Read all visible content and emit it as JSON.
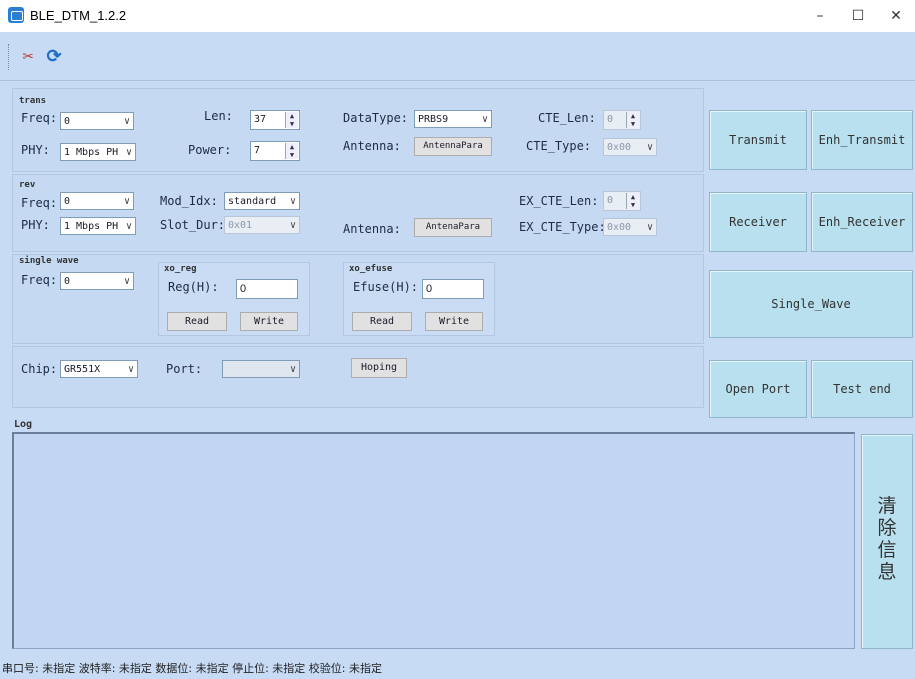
{
  "window": {
    "title": "BLE_DTM_1.2.2",
    "minimize": "–",
    "maximize": "☐",
    "close": "✕"
  },
  "toolbar": {
    "tools_icon": "✂",
    "refresh_icon": "⟳"
  },
  "trans": {
    "group": "trans",
    "freq_label": "Freq:",
    "freq_value": "0",
    "phy_label": "PHY:",
    "phy_value": "1 Mbps PH",
    "len_label": "Len:",
    "len_value": "37",
    "power_label": "Power:",
    "power_value": "7",
    "datatype_label": "DataType:",
    "datatype_value": "PRBS9",
    "antenna_label": "Antenna:",
    "antenna_button": "AntennaPara",
    "cte_len_label": "CTE_Len:",
    "cte_len_value": "0",
    "cte_type_label": "CTE_Type:",
    "cte_type_value": "0x00",
    "transmit": "Transmit",
    "enh_transmit": "Enh_Transmit"
  },
  "rev": {
    "group": "rev",
    "freq_label": "Freq:",
    "freq_value": "0",
    "phy_label": "PHY:",
    "phy_value": "1 Mbps PH",
    "mod_idx_label": "Mod_Idx:",
    "mod_idx_value": "standard",
    "slot_dur_label": "Slot_Dur:",
    "slot_dur_value": "0x01",
    "antenna_label": "Antenna:",
    "antenna_button": "AntenaPara",
    "ex_cte_len_label": "EX_CTE_Len:",
    "ex_cte_len_value": "0",
    "ex_cte_type_label": "EX_CTE_Type:",
    "ex_cte_type_value": "0x00",
    "receiver": "Receiver",
    "enh_receiver": "Enh_Receiver"
  },
  "single_wave": {
    "group": "single wave",
    "freq_label": "Freq:",
    "freq_value": "0",
    "xo_reg_group": "xo_reg",
    "reg_label": "Reg(H):",
    "reg_value": "0",
    "xo_efuse_group": "xo_efuse",
    "efuse_label": "Efuse(H):",
    "efuse_value": "0",
    "read": "Read",
    "write": "Write",
    "single_wave_button": "Single_Wave"
  },
  "port": {
    "chip_label": "Chip:",
    "chip_value": "GR551X",
    "port_label": "Port:",
    "port_value": "",
    "hoping": "Hoping",
    "open_port": "Open Port",
    "test_end": "Test end"
  },
  "log": {
    "label": "Log",
    "clear_button": "清除信息"
  },
  "status_bar": "串口号: 未指定  波特率: 未指定  数据位: 未指定  停止位: 未指定  校验位: 未指定"
}
